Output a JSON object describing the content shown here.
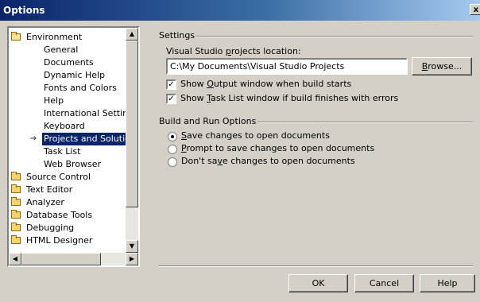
{
  "window": {
    "title": "Options",
    "close_glyph": "x"
  },
  "tree": {
    "items": [
      {
        "label": "Environment",
        "type": "folder-open",
        "level": 0
      },
      {
        "label": "General",
        "level": 1
      },
      {
        "label": "Documents",
        "level": 1
      },
      {
        "label": "Dynamic Help",
        "level": 1
      },
      {
        "label": "Fonts and Colors",
        "level": 1
      },
      {
        "label": "Help",
        "level": 1
      },
      {
        "label": "International Settings",
        "level": 1
      },
      {
        "label": "Keyboard",
        "level": 1
      },
      {
        "label": "Projects and Solutions",
        "level": 1,
        "selected": true
      },
      {
        "label": "Task List",
        "level": 1
      },
      {
        "label": "Web Browser",
        "level": 1
      },
      {
        "label": "Source Control",
        "type": "folder",
        "level": 0
      },
      {
        "label": "Text Editor",
        "type": "folder",
        "level": 0
      },
      {
        "label": "Analyzer",
        "type": "folder",
        "level": 0
      },
      {
        "label": "Database Tools",
        "type": "folder",
        "level": 0
      },
      {
        "label": "Debugging",
        "type": "folder",
        "level": 0
      },
      {
        "label": "HTML Designer",
        "type": "folder",
        "level": 0
      }
    ]
  },
  "settings": {
    "group_label": "Settings",
    "location_label": "Visual Studio projects location:",
    "location_value": "C:\\My Documents\\Visual Studio Projects",
    "browse_label": "Browse...",
    "show_output_label": "Show Output window when build starts",
    "show_output_checked": true,
    "show_tasklist_label": "Show Task List window if build finishes with errors",
    "show_tasklist_checked": true
  },
  "build": {
    "group_label": "Build and Run Options",
    "options": [
      {
        "label": "Save changes to open documents",
        "selected": true
      },
      {
        "label": "Prompt to save changes to open documents",
        "selected": false
      },
      {
        "label": "Don't save changes to open documents",
        "selected": false
      }
    ]
  },
  "buttons": {
    "ok": "OK",
    "cancel": "Cancel",
    "help": "Help"
  }
}
